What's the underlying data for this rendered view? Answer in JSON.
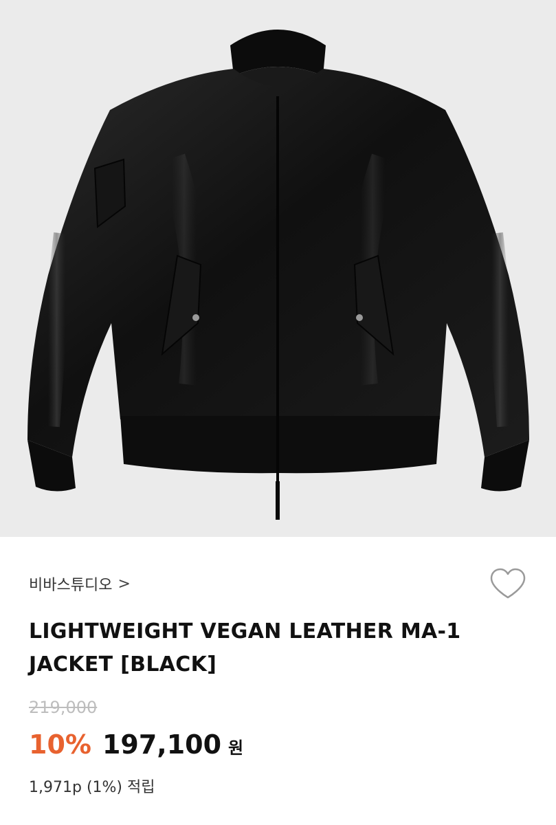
{
  "product_image": {
    "alt": "Black vegan leather MA-1 bomber jacket",
    "background": "#ebebeb",
    "jacket_color": "#111111"
  },
  "brand": {
    "name": "비바스튜디오",
    "chevron": ">"
  },
  "wishlist": {
    "icon": "heart-outline-icon"
  },
  "product": {
    "title": "LIGHTWEIGHT VEGAN LEATHER MA-1 JACKET [BLACK]",
    "original_price": "219,000",
    "discount": "10%",
    "sale_price": "197,100",
    "currency": "원",
    "points": "1,971p (1%) 적립"
  },
  "colors": {
    "discount": "#e8622f",
    "strikethrough": "#bdbdbd"
  }
}
